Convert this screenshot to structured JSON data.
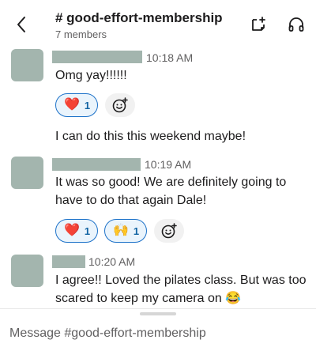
{
  "header": {
    "channel_name": "# good-effort-membership",
    "member_count": "7 members"
  },
  "messages": [
    {
      "timestamp": "10:18 AM",
      "text": "Omg yay!!!!!!",
      "reactions": [
        {
          "emoji": "❤️",
          "count": "1"
        }
      ]
    },
    {
      "text": "I can do this this weekend maybe!"
    },
    {
      "timestamp": "10:19 AM",
      "text": "It was so good! We are definitely going to have to do that again Dale!",
      "reactions": [
        {
          "emoji": "❤️",
          "count": "1"
        },
        {
          "emoji": "🙌",
          "count": "1"
        }
      ]
    },
    {
      "timestamp": "10:20 AM",
      "text": "I agree!! Loved the pilates class. But was too scared to keep my camera on 😂"
    }
  ],
  "composer": {
    "placeholder": "Message #good-effort-membership"
  },
  "colors": {
    "accent": "#1d72c9",
    "reaction_bg": "#eaf4fc",
    "avatar": "#a3b5ae"
  }
}
